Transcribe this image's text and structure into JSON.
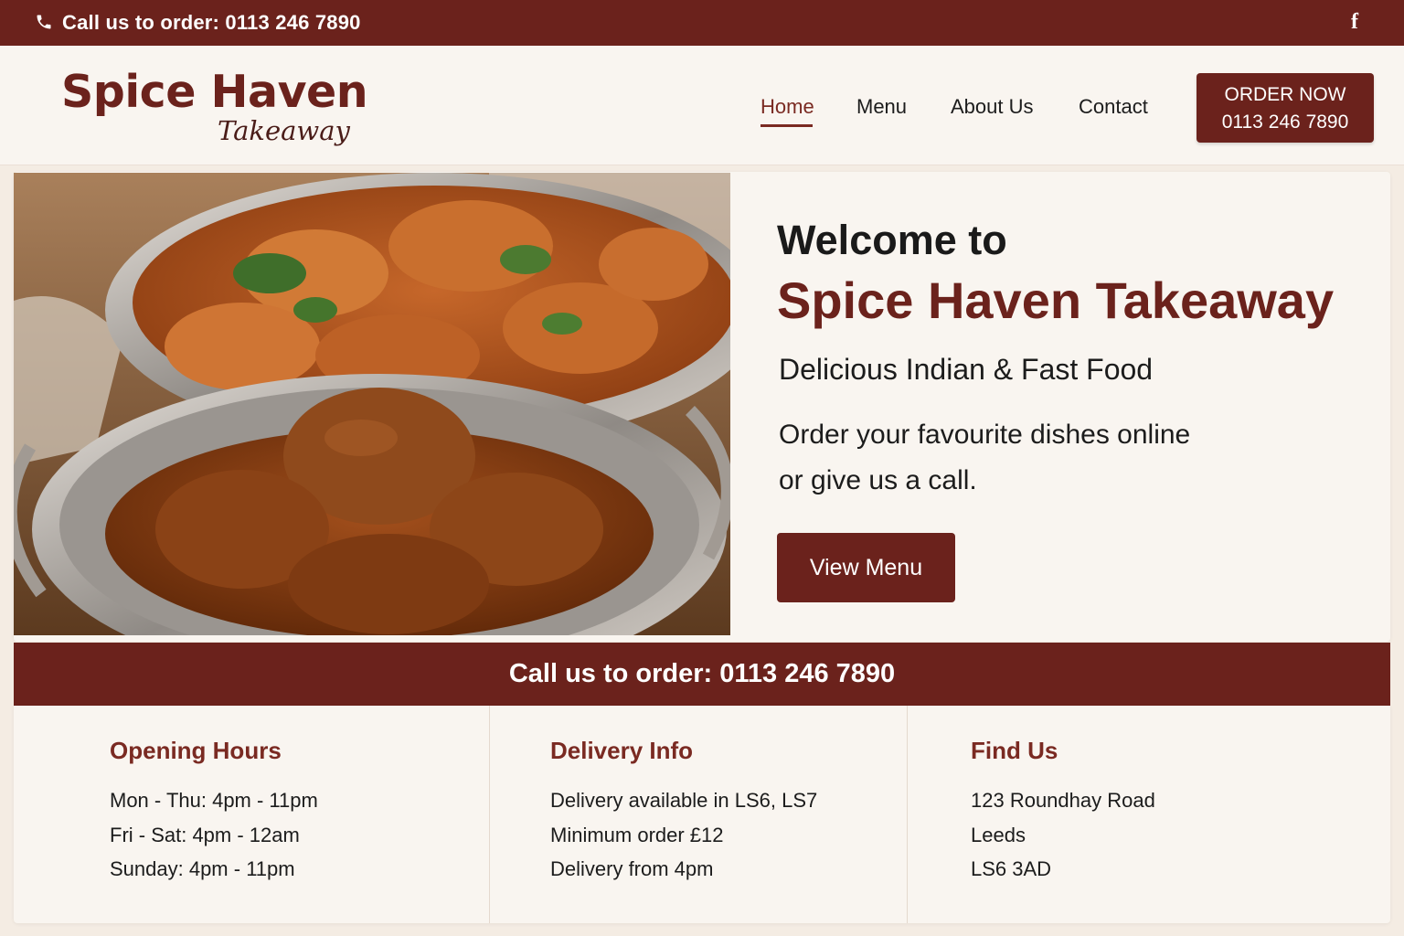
{
  "topbar": {
    "phone_text": "Call us to order: 0113 246 7890",
    "facebook_icon": "f"
  },
  "header": {
    "logo_main": "Spice Haven",
    "logo_sub": "Takeaway",
    "nav": [
      "Home",
      "Menu",
      "About Us",
      "Contact"
    ],
    "active_nav": "Home",
    "order_button": {
      "line1": "ORDER NOW",
      "line2": "0113 246 7890"
    }
  },
  "hero": {
    "welcome": "Welcome to",
    "title": "Spice Haven Takeaway",
    "subtitle": "Delicious Indian & Fast Food",
    "desc_line1": "Order your favourite dishes online",
    "desc_line2": "or give us a call.",
    "cta": "View Menu"
  },
  "callbar": {
    "text": "Call us to order: 0113 246 7890"
  },
  "info": {
    "hours": {
      "title": "Opening Hours",
      "lines": [
        "Mon - Thu: 4pm - 11pm",
        "Fri - Sat: 4pm - 12am",
        "Sunday: 4pm - 11pm"
      ]
    },
    "delivery": {
      "title": "Delivery Info",
      "lines": [
        "Delivery available in LS6, LS7",
        "Minimum order £12",
        "Delivery from 4pm"
      ]
    },
    "find": {
      "title": "Find Us",
      "lines": [
        "123 Roundhay Road",
        "Leeds",
        "LS6 3AD"
      ]
    }
  },
  "colors": {
    "brand": "#6b221c",
    "background": "#f4ece3",
    "card": "#f9f5f0"
  }
}
